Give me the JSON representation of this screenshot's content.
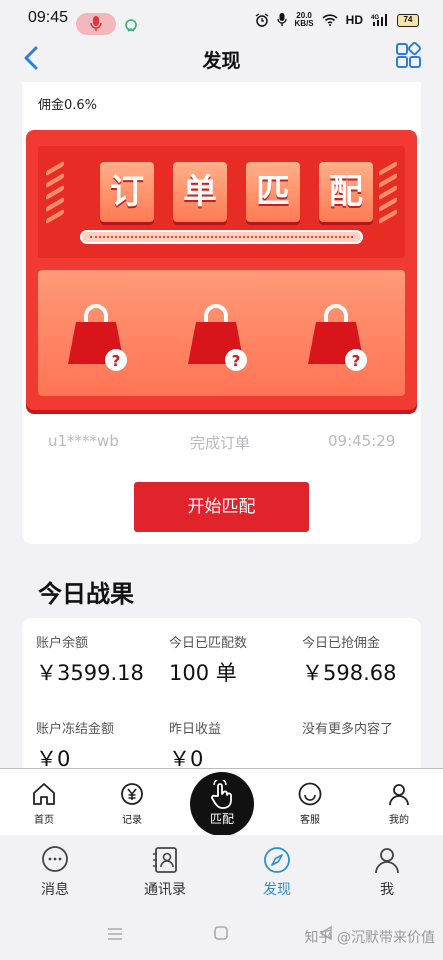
{
  "status_bar": {
    "time": "09:45",
    "speed_value": "20.0",
    "speed_unit": "KB/S",
    "hd": "HD",
    "network": "4G",
    "battery": "74"
  },
  "header": {
    "title": "发现"
  },
  "card": {
    "commission": "佣金0.6%",
    "tiles": [
      "订",
      "单",
      "匹",
      "配"
    ],
    "ticker": {
      "user": "u1****wb",
      "action": "完成订单",
      "time": "09:45:29"
    },
    "start_button": "开始匹配"
  },
  "results": {
    "title": "今日战果",
    "stats": [
      {
        "label": "账户余额",
        "value": "￥3599.18"
      },
      {
        "label": "今日已匹配数",
        "value": "100 单"
      },
      {
        "label": "今日已抢佣金",
        "value": "￥598.68"
      },
      {
        "label": "账户冻结金额",
        "value": "￥0"
      },
      {
        "label": "昨日收益",
        "value": "￥0"
      },
      {
        "label": "没有更多内容了",
        "value": ""
      }
    ]
  },
  "inner_tabs": [
    {
      "label": "首页",
      "icon": "home-icon"
    },
    {
      "label": "记录",
      "icon": "yuan-record-icon"
    },
    {
      "label": "匹配",
      "icon": "tap-hand-icon"
    },
    {
      "label": "客服",
      "icon": "smile-icon"
    },
    {
      "label": "我的",
      "icon": "person-icon"
    }
  ],
  "outer_tabs": [
    {
      "label": "消息",
      "icon": "chat-icon"
    },
    {
      "label": "通讯录",
      "icon": "contacts-icon"
    },
    {
      "label": "发现",
      "icon": "compass-icon"
    },
    {
      "label": "我",
      "icon": "person-icon"
    }
  ],
  "watermark": "知乎 @沉默带来价值",
  "colors": {
    "accent_red": "#e1232c",
    "tab_active": "#2a8fd9"
  }
}
